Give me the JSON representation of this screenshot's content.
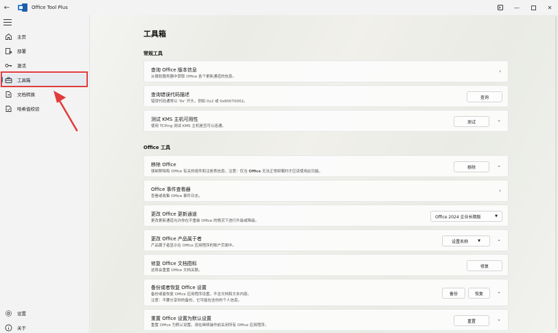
{
  "titlebar": {
    "title": "Office Tool Plus",
    "icons": [
      "back-arrow-icon",
      "office-logo-icon",
      "terminal-icon",
      "minimize-icon",
      "maximize-icon",
      "close-icon"
    ]
  },
  "sidebar": {
    "items": [
      {
        "label": "主页",
        "icon": "home-icon"
      },
      {
        "label": "部署",
        "icon": "deploy-icon"
      },
      {
        "label": "激活",
        "icon": "key-icon"
      },
      {
        "label": "工具箱",
        "icon": "toolbox-icon",
        "active": true
      },
      {
        "label": "文档转换",
        "icon": "document-convert-icon"
      },
      {
        "label": "哈希值校验",
        "icon": "hash-check-icon"
      }
    ],
    "bottom": [
      {
        "label": "设置",
        "icon": "gear-icon"
      },
      {
        "label": "关于",
        "icon": "info-icon"
      }
    ]
  },
  "main": {
    "page_title": "工具箱",
    "sections": {
      "general": "常规工具",
      "office": "Office 工具"
    },
    "cards": {
      "version_info": {
        "title": "查询 Office 版本信息",
        "desc": "从微软服务器中获取 Office 各个更新通道的信息。"
      },
      "error_code": {
        "title": "查询错误代码描述",
        "desc": "错误代码通常以 '0x' 开头，例如 0x2 或 0x80070002。",
        "button": "查询"
      },
      "kms_test": {
        "title": "测试 KMS 主机可用性",
        "desc": "使用 TCPing 测试 KMS 主机是否可以连通。",
        "button": "测试"
      },
      "remove_office": {
        "title": "移除 Office",
        "desc_prefix": "强制移除和 Office 有关的组件和注册表信息。注意：仅当 ",
        "desc_bold": "Office",
        "desc_suffix": " 无法正常卸载时才应该使用此功能。",
        "button": "移除"
      },
      "event_viewer": {
        "title": "Office 事件查看器",
        "desc": "查看或收集 Office 事件日志。"
      },
      "update_channel": {
        "title": "更改 Office 更新通道",
        "desc": "更改更新通道允许你在不重装 Office 的情况下进行升级或降级。",
        "dropdown": "Office 2024 企业长期版"
      },
      "owner": {
        "title": "更改 Office 产品属于者",
        "desc": "产品属于者显示在 Office 应用程序的账户页面中。",
        "button": "设置名称"
      },
      "repair_icons": {
        "title": "修复 Office 文档图标",
        "desc": "这将会重置 Office 文档关联。",
        "button": "修复"
      },
      "backup": {
        "title": "备份或者恢复 Office 设置",
        "desc1": "备份或者恢复 Office 应用程序设置，不含文档和文本内容。",
        "desc2": "注意：不要分享你的备份，它可能包含你的个人信息。",
        "button_backup": "备份",
        "button_restore": "恢复"
      },
      "reset": {
        "title": "重置 Office 设置为默认设置",
        "desc": "重置 Office 为默认设置。请在继续操作前关闭所有 Office 应用程序。",
        "button": "重置"
      }
    }
  },
  "colors": {
    "accent": "#0067c0",
    "annotation": "#e23b3b"
  }
}
